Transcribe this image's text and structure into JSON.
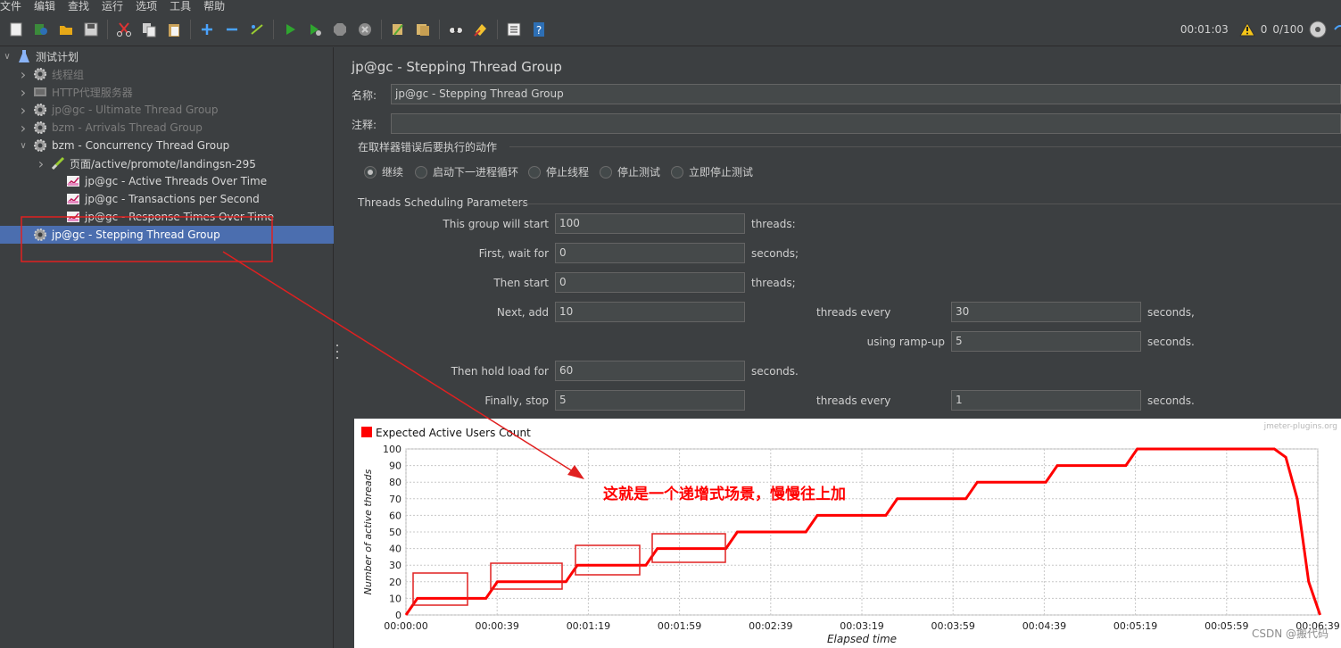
{
  "menubar": {
    "items": [
      "文件",
      "编辑",
      "查找",
      "运行",
      "选项",
      "工具",
      "帮助"
    ]
  },
  "toolbar": {
    "buttons": [
      "new-icon",
      "templates-icon",
      "open-icon",
      "save-icon",
      "cut-icon",
      "copy-icon",
      "paste-icon",
      "expand-icon",
      "collapse-icon",
      "toggle-icon",
      "start-icon",
      "start-no-pause-icon",
      "stop-icon",
      "shutdown-icon",
      "clear-icon",
      "clear-all-icon",
      "search-icon",
      "reset-search-icon",
      "function-helper-icon",
      "help-icon"
    ],
    "elapsed": "00:01:03",
    "warning_count": "0",
    "threads": "0/100"
  },
  "tree": {
    "root": "测试计划",
    "items": [
      {
        "label": "线程组",
        "enabled": false,
        "icon": "gear-icon"
      },
      {
        "label": "HTTP代理服务器",
        "enabled": false,
        "icon": "proxy-icon"
      },
      {
        "label": "jp@gc - Ultimate Thread Group",
        "enabled": false,
        "icon": "gear-icon"
      },
      {
        "label": "bzm - Arrivals Thread Group",
        "enabled": false,
        "icon": "gear-icon"
      },
      {
        "label": "bzm - Concurrency Thread Group",
        "enabled": true,
        "icon": "gear-icon"
      },
      {
        "label": "页面/active/promote/landingsn-295",
        "enabled": true,
        "icon": "sampler-icon"
      },
      {
        "label": "jp@gc - Active Threads Over Time",
        "enabled": true,
        "icon": "graph-icon"
      },
      {
        "label": "jp@gc - Transactions per Second",
        "enabled": true,
        "icon": "graph-icon"
      },
      {
        "label": "jp@gc - Response Times Over Time",
        "enabled": true,
        "icon": "graph-icon"
      },
      {
        "label": "jp@gc - Stepping Thread Group",
        "enabled": true,
        "icon": "gear-icon"
      }
    ]
  },
  "panel": {
    "title": "jp@gc - Stepping Thread Group",
    "name_label": "名称:",
    "name_value": "jp@gc - Stepping Thread Group",
    "comment_label": "注释:",
    "comment_value": "",
    "error_section": "在取样器错误后要执行的动作",
    "error_actions": [
      "继续",
      "启动下一进程循环",
      "停止线程",
      "停止测试",
      "立即停止测试"
    ],
    "error_selected": 0,
    "sched_section": "Threads Scheduling Parameters",
    "start_label": "This group will start",
    "start_value": "100",
    "start_unit": "threads:",
    "wait_label": "First, wait for",
    "wait_value": "0",
    "wait_unit": "seconds;",
    "then_label": "Then start",
    "then_value": "0",
    "then_unit": "threads;",
    "next_label": "Next, add",
    "next_value": "10",
    "every_label": "threads every",
    "every_value": "30",
    "every_unit": "seconds,",
    "rampup_label": "using ramp-up",
    "rampup_value": "5",
    "rampup_unit": "seconds.",
    "hold_label": "Then hold load for",
    "hold_value": "60",
    "hold_unit": "seconds.",
    "stop_label": "Finally, stop",
    "stop_value": "5",
    "stop_every_label": "threads every",
    "stop_every_value": "1",
    "stop_every_unit": "seconds."
  },
  "chart_data": {
    "type": "line",
    "legend": "Expected Active Users Count",
    "brand": "jmeter-plugins.org",
    "xlabel": "Elapsed time",
    "ylabel": "Number of active threads",
    "ylim": [
      0,
      100
    ],
    "yticks": [
      0,
      10,
      20,
      30,
      40,
      50,
      60,
      70,
      80,
      90,
      100
    ],
    "xlim": [
      0,
      399
    ],
    "xticks": [
      "00:00:00",
      "00:00:39",
      "00:01:19",
      "00:01:59",
      "00:02:39",
      "00:03:19",
      "00:03:59",
      "00:04:39",
      "00:05:19",
      "00:05:59",
      "00:06:39"
    ],
    "grid": true,
    "series": [
      {
        "name": "Expected Active Users Count",
        "color": "#ff0000",
        "x": [
          0,
          5,
          35,
          40,
          70,
          75,
          105,
          110,
          140,
          145,
          175,
          180,
          210,
          215,
          245,
          250,
          280,
          285,
          315,
          320,
          380,
          385,
          386,
          387,
          388,
          389,
          390,
          391,
          392,
          393,
          394,
          395,
          400
        ],
        "y": [
          0,
          10,
          10,
          20,
          20,
          30,
          30,
          40,
          40,
          50,
          50,
          60,
          60,
          70,
          70,
          80,
          80,
          90,
          90,
          100,
          100,
          95,
          90,
          85,
          80,
          75,
          70,
          60,
          50,
          40,
          30,
          20,
          0
        ]
      }
    ]
  },
  "annotation": {
    "text": "这就是一个递增式场景，慢慢往上加",
    "color": "#ff0000"
  },
  "watermark": "CSDN @搬代码"
}
